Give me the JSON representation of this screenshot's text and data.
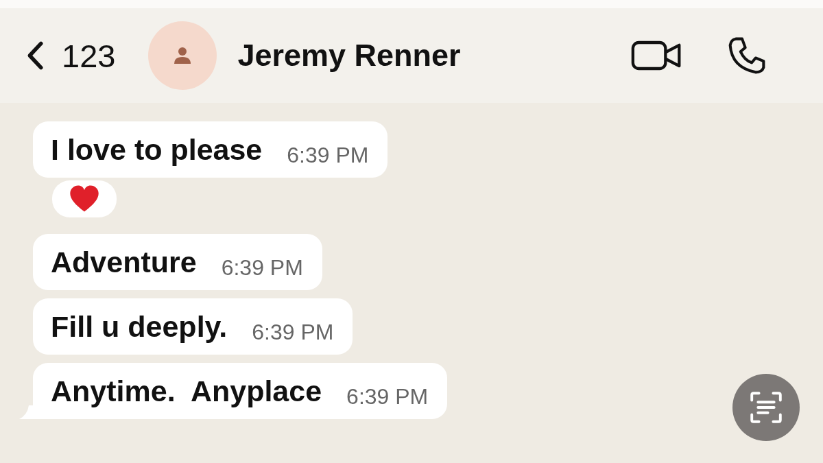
{
  "header": {
    "back_label": "123",
    "contact_name": "Jeremy Renner"
  },
  "messages": [
    {
      "text": "I love to please",
      "time": "6:39 PM",
      "heart_reaction": true,
      "tail": false
    },
    {
      "text": "Adventure",
      "time": "6:39 PM",
      "heart_reaction": false,
      "tail": false
    },
    {
      "text": "Fill u deeply.",
      "time": "6:39 PM",
      "heart_reaction": false,
      "tail": false
    },
    {
      "text": "Anytime.  Anyplace",
      "time": "6:39 PM",
      "heart_reaction": false,
      "tail": true
    }
  ]
}
